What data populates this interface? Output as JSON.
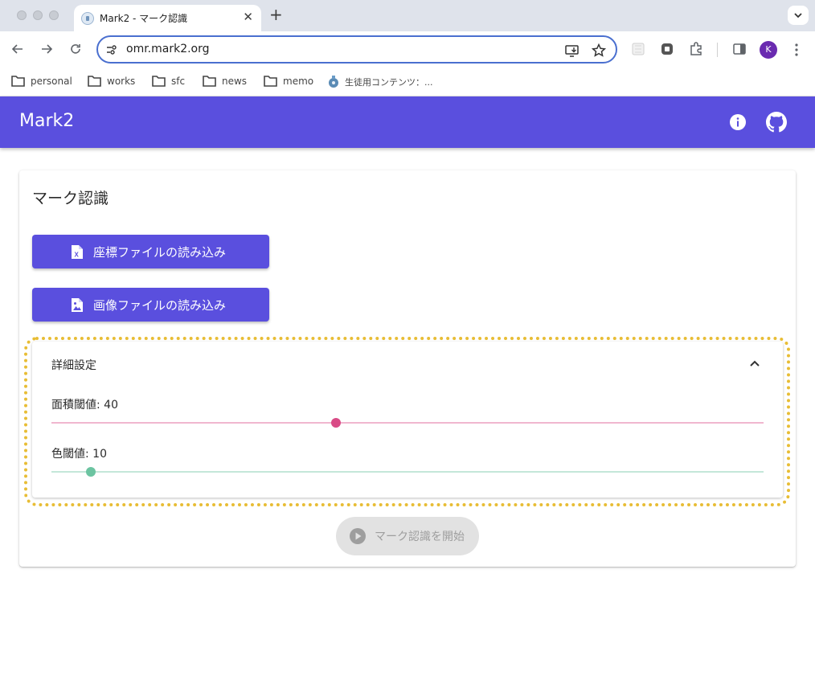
{
  "browser": {
    "tab_title": "Mark2 - マーク認識",
    "tab_close": "✕",
    "new_tab": "+",
    "url": "omr.mark2.org",
    "profile_initial": "K",
    "bookmarks": [
      "personal",
      "works",
      "sfc",
      "news",
      "memo",
      "生徒用コンテンツ：..."
    ]
  },
  "app": {
    "title": "Mark2",
    "brand_color": "#5a4fde"
  },
  "card": {
    "title": "マーク認識",
    "load_coords_button": "座標ファイルの読み込み",
    "load_image_button": "画像ファイルの読み込み",
    "advanced": {
      "title": "詳細設定",
      "area_threshold": {
        "label": "面積閾値: 40",
        "value": 40,
        "min": 0,
        "max": 100,
        "color": "#d94b86"
      },
      "color_threshold": {
        "label": "色閾値: 10",
        "value": 10,
        "min": 0,
        "max": 180,
        "color": "#6cc4a1"
      }
    },
    "start_button": "マーク認識を開始"
  }
}
